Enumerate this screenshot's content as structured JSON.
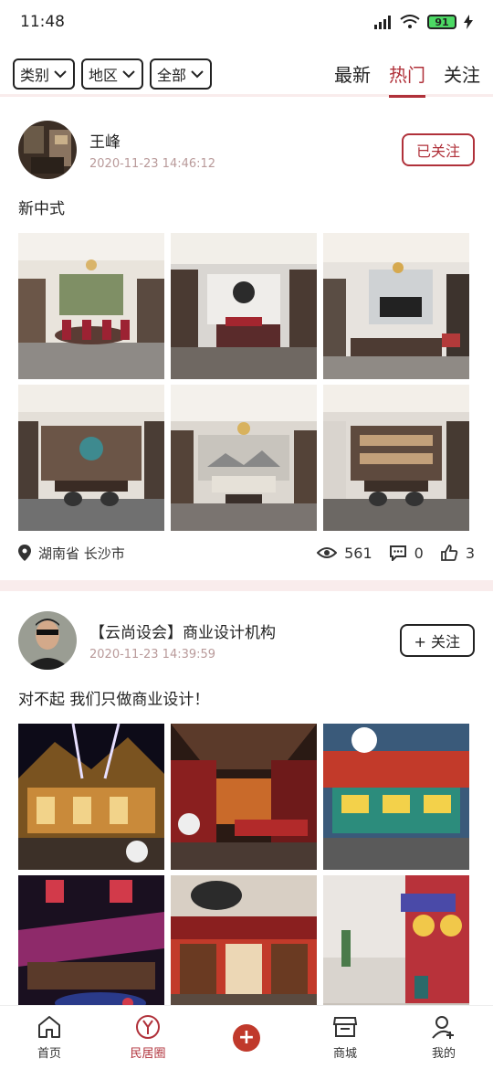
{
  "status": {
    "time": "11:48",
    "battery": "91"
  },
  "filters": [
    {
      "label": "类别"
    },
    {
      "label": "地区"
    },
    {
      "label": "全部"
    }
  ],
  "sort_tabs": [
    {
      "label": "最新",
      "active": false
    },
    {
      "label": "热门",
      "active": true
    },
    {
      "label": "关注",
      "active": false
    }
  ],
  "posts": [
    {
      "author": "王峰",
      "time": "2020-11-23 14:46:12",
      "follow_label": "已关注",
      "text": "新中式",
      "location": "湖南省 长沙市",
      "views": "561",
      "comments": "0",
      "likes": "3"
    },
    {
      "author": "【云尚设会】商业设计机构",
      "time": "2020-11-23 14:39:59",
      "follow_label": "+ 关注",
      "text": "对不起 我们只做商业设计！"
    }
  ],
  "nav": [
    {
      "label": "首页",
      "icon": "home-icon"
    },
    {
      "label": "民居圈",
      "icon": "community-icon",
      "active": true
    },
    {
      "label": "",
      "icon": "plus-icon"
    },
    {
      "label": "商城",
      "icon": "shop-icon"
    },
    {
      "label": "我的",
      "icon": "profile-icon"
    }
  ],
  "colors": {
    "accent": "#b0313a",
    "divider": "#f9ecec"
  }
}
